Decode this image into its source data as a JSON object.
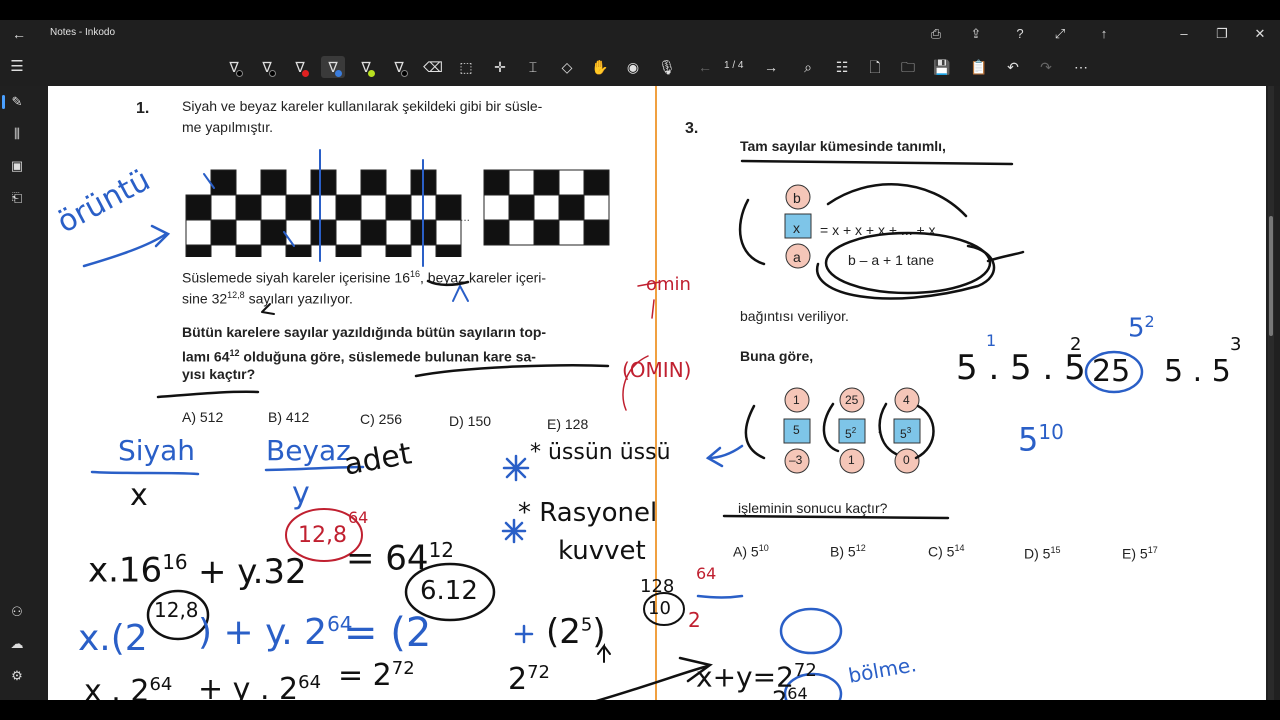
{
  "window": {
    "title": "Notes - Inkodo"
  },
  "toolbar": {
    "page_indicator": "1 / 4",
    "pen_colors": [
      "#000000",
      "#000000",
      "#e02020",
      "#3b7ddd",
      "#b8e020",
      "#000000"
    ]
  },
  "worksheet": {
    "q1": {
      "number": "1.",
      "text_a": "Siyah ve beyaz kareler kullanılarak şekildeki gibi bir süsle-",
      "text_b": "me yapılmıştır.",
      "text_c": "Süslemede siyah kareler içerisine 16",
      "exp_c": "16",
      "text_d": ", beyaz kareler içeri-",
      "text_e": "sine 32",
      "exp_e": "12,8",
      "text_f": " sayıları yazılıyor.",
      "bold_a": "Bütün karelere sayılar yazıldığında bütün sayıların top-",
      "bold_b": "lamı 64",
      "bold_b_exp": "12",
      "bold_b2": " olduğuna göre, süslemede bulunan kare sa-",
      "bold_c": "yısı kaçtır?",
      "ellipsis": "...",
      "options": [
        "A) 512",
        "B) 412",
        "C) 256",
        "D) 150",
        "E) 128"
      ]
    },
    "q3": {
      "number": "3.",
      "heading": "Tam sayılar kümesinde tanımlı,",
      "def_top": "b",
      "def_mid": "x",
      "def_bottom": "a",
      "def_expr": "= x + x + x + ... + x",
      "def_brace": "b – a + 1 tane",
      "relation": "bağıntısı veriliyor.",
      "buna": "Buna göre,",
      "c1": [
        "1",
        "5",
        "–3"
      ],
      "c2": [
        "25",
        "5",
        "1"
      ],
      "c2_exp": "2",
      "c3": [
        "4",
        "5",
        "0"
      ],
      "c3_exp": "3",
      "dot": "·",
      "question": "işleminin sonucu kaçtır?",
      "options": [
        "A) 5",
        "B) 5",
        "C) 5",
        "D) 5",
        "E) 5"
      ],
      "option_exps": [
        "10",
        "12",
        "14",
        "15",
        "17"
      ]
    }
  },
  "handwriting": {
    "oruntu": "örüntü",
    "siyah": "Siyah",
    "beyaz": "Beyaz",
    "adet": "adet",
    "x": "x",
    "y": "y",
    "x16": "x.16",
    "x16_exp": "16",
    "y32": "+ y.32",
    "y32_exp": "12,8",
    "eq1": "= 64",
    "eq1_exp": "12",
    "circle1": "12,8",
    "circle1_alt": "64",
    "line2": "x.(2",
    "line2b": ") + y. 2",
    "line2b_exp": "64",
    "line2c": "= (2",
    "circ_6412": "6.12",
    "line3": "x . 2",
    "line3_exp": "64",
    "line3b": "+ y . 2",
    "line3b_exp": "64",
    "line3c": "= 2",
    "line3c_exp": "72",
    "line3d": "2",
    "line3d_exp": "72",
    "usun_ussu": "* üssün üssü",
    "rasyonel": "* Rasyonel",
    "kuvvet": "kuvvet",
    "pow25": "(2",
    "pow25_exp": "5",
    "pow25b": ")",
    "frac_num": "128",
    "frac_den": "10",
    "frac_alt": "64",
    "frac_alt2": "2",
    "omin": "omin",
    "omin_box": "(OMIN)",
    "xy": "x+y=2",
    "xy_exp": "72",
    "xy_den": "2",
    "xy_den_exp": "64",
    "bolme": "bölme.",
    "r_expr": "5 . 5 . 5",
    "r_expr_e1": "1",
    "r_expr_e2": "2",
    "r_expr_e3": "25",
    "r_expr_e4": "5 . 5",
    "r_expr_e5": "3",
    "five_sq": "5",
    "five_sq_exp": "2",
    "five10": "5",
    "five10_exp": "10"
  }
}
